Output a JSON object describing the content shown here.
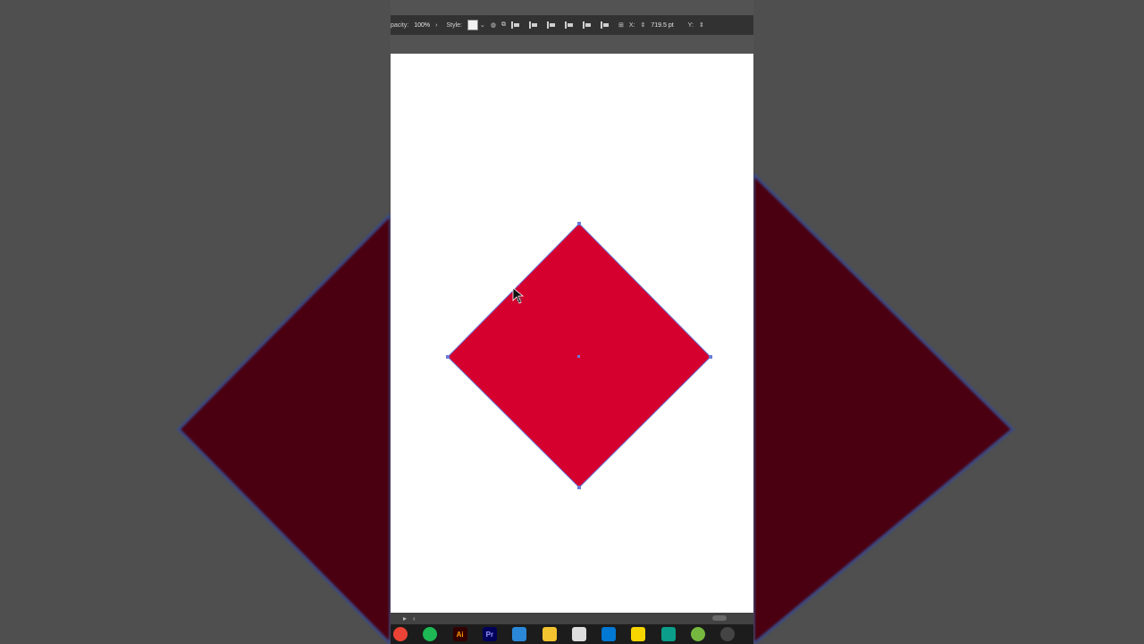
{
  "control_bar": {
    "opacity_label": "pacity:",
    "opacity_value": "100%",
    "style_label": "Style:",
    "x_label": "X:",
    "x_value": "719.5 pt",
    "y_label": "Y:"
  },
  "canvas": {
    "shape": "diamond",
    "fill_color": "#D6002F",
    "stroke_color": "#5a6fd6",
    "background_side_color": "#4a0010"
  },
  "taskbar": {
    "apps": [
      {
        "name": "chrome-icon",
        "color": "#ea4335"
      },
      {
        "name": "spotify-icon",
        "color": "#1db954"
      },
      {
        "name": "illustrator-icon",
        "color": "#330000",
        "text": "Ai",
        "text_color": "#ff9a00"
      },
      {
        "name": "premiere-icon",
        "color": "#00005b",
        "text": "Pr",
        "text_color": "#9999ff"
      },
      {
        "name": "mail-icon",
        "color": "#2b88d8"
      },
      {
        "name": "file-explorer-icon",
        "color": "#f4c430"
      },
      {
        "name": "library-icon",
        "color": "#dddddd"
      },
      {
        "name": "store-icon",
        "color": "#0078d4"
      },
      {
        "name": "sticky-notes-icon",
        "color": "#f7d600"
      },
      {
        "name": "filmora-icon",
        "color": "#0b9e8a"
      },
      {
        "name": "utorrent-icon",
        "color": "#76b83f"
      },
      {
        "name": "obs-icon",
        "color": "#444444"
      }
    ]
  }
}
